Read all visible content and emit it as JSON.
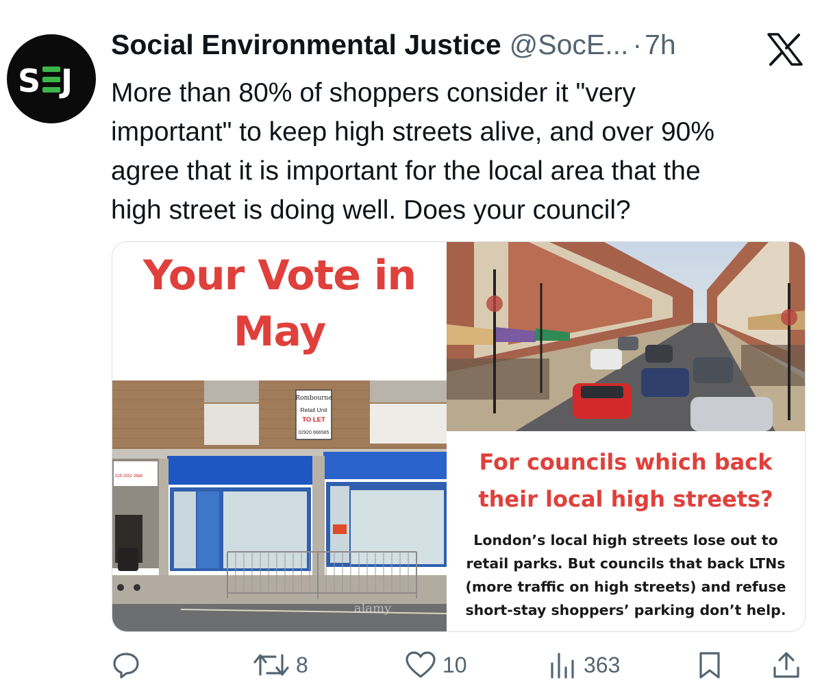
{
  "tweet": {
    "author_name": "Social Environmental Justice",
    "author_handle": "@SocE...",
    "separator": "·",
    "time": "7h",
    "avatar_text": "SEJ",
    "text_lines": [
      "More than 80% of shoppers consider it \"very",
      "important\" to keep high streets alive, and over 90%",
      "agree that it is important for the local area that the",
      "high street is doing well. Does your council?"
    ]
  },
  "media": {
    "headline_lines": [
      "Your Vote in",
      "May"
    ],
    "question_lines": [
      "For councils which back",
      "their local high streets?"
    ],
    "body_lines": [
      "London’s local high streets lose out to",
      "retail parks. But councils that back LTNs",
      "(more traffic on high streets) and refuse",
      "short-stay shoppers’ parking don’t help."
    ],
    "shop_sign": {
      "brand": "Rombourne",
      "line1": "Retail Unit",
      "line2": "TO LET",
      "phone": "02920 666565",
      "side_phone": "029 2052 2888"
    },
    "watermark": "alamy"
  },
  "actions": {
    "reply": {
      "icon": "reply-icon",
      "count": ""
    },
    "retweet": {
      "icon": "retweet-icon",
      "count": "8"
    },
    "like": {
      "icon": "heart-icon",
      "count": "10"
    },
    "views": {
      "icon": "views-icon",
      "count": "363"
    },
    "bookmark": {
      "icon": "bookmark-icon"
    },
    "share": {
      "icon": "share-icon"
    }
  },
  "colors": {
    "accent_red": "#e0403b",
    "brand_green": "#3bb54a",
    "muted_text": "#536471"
  }
}
